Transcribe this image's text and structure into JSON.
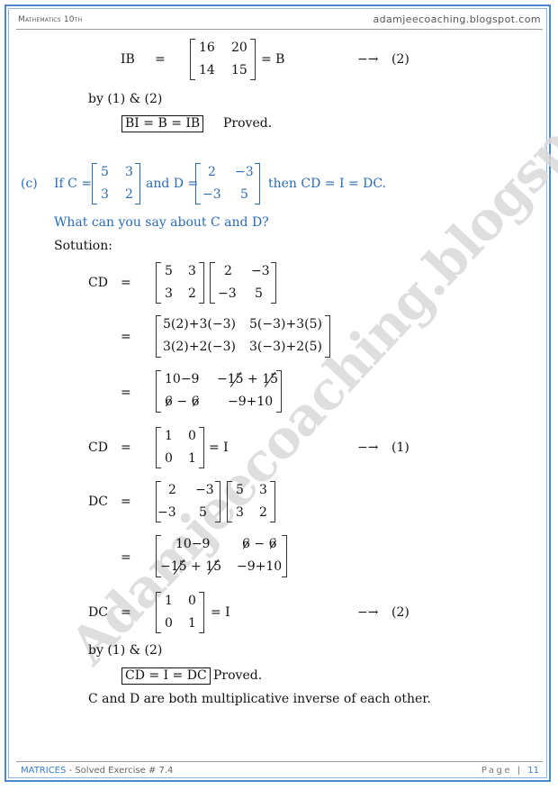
{
  "header": {
    "subject": "Mathematics 10th",
    "website": "adamjeecoaching.blogspot.com"
  },
  "footer": {
    "chapter": "MATRICES",
    "section": " - Solved Exercise # 7.4",
    "page_label": "Page",
    "page_number": "11"
  },
  "watermark": "Adamjeecoaching.blogspot.com",
  "colors": {
    "accent_blue": "#2a6bb5",
    "frame_blue": "#4a86c8"
  },
  "part_b_tail": {
    "ib_label": "IB",
    "eq": "=",
    "ib_matrix": [
      [
        "16",
        "20"
      ],
      [
        "14",
        "15"
      ]
    ],
    "ib_result": "= B",
    "arrow": "−→",
    "ref": "(2)",
    "by_line": "by (1) & (2)",
    "conclusion_boxed": "BI  =  B  =  IB",
    "proved": "Proved."
  },
  "part_c": {
    "label": "(c)",
    "if_text": "If  C =",
    "C": [
      [
        "5",
        "3"
      ],
      [
        "3",
        "2"
      ]
    ],
    "and_text": "and D =",
    "D": [
      [
        "2",
        "−3"
      ],
      [
        "−3",
        "5"
      ]
    ],
    "then_text": "then CD = I = DC.",
    "question": "What can you say about C and D?",
    "solution_label": "Sotution:",
    "steps": [
      {
        "lhs": "CD",
        "eq": "=",
        "left": [
          [
            "5",
            "3"
          ],
          [
            "3",
            "2"
          ]
        ],
        "right": [
          [
            "2",
            "−3"
          ],
          [
            "−3",
            "5"
          ]
        ]
      },
      {
        "lhs": "",
        "eq": "=",
        "matrix": [
          [
            "5(2)+3(−3)",
            "5(−3)+3(5)"
          ],
          [
            "3(2)+2(−3)",
            "3(−3)+2(5)"
          ]
        ]
      },
      {
        "lhs": "",
        "eq": "=",
        "matrix": [
          [
            "10−9",
            "−15 + 15"
          ],
          [
            "6 − 6",
            "−9+10"
          ]
        ],
        "cancelled": "15, 6"
      },
      {
        "lhs": "CD",
        "eq": "=",
        "matrix": [
          [
            "1",
            "0"
          ],
          [
            "0",
            "1"
          ]
        ],
        "result": "= I",
        "arrow": "−→",
        "ref": "(1)"
      },
      {
        "lhs": "DC",
        "eq": "=",
        "left": [
          [
            "2",
            "−3"
          ],
          [
            "−3",
            "5"
          ]
        ],
        "right": [
          [
            "5",
            "3"
          ],
          [
            "3",
            "2"
          ]
        ]
      },
      {
        "lhs": "",
        "eq": "=",
        "matrix": [
          [
            "10−9",
            "6 − 6"
          ],
          [
            "−15 + 15",
            "−9+10"
          ]
        ],
        "cancelled": "6, 15"
      },
      {
        "lhs": "DC",
        "eq": "=",
        "matrix": [
          [
            "1",
            "0"
          ],
          [
            "0",
            "1"
          ]
        ],
        "result": "= I",
        "arrow": "−→",
        "ref": "(2)"
      }
    ],
    "by_line": "by (1) & (2)",
    "conclusion_boxed": "CD  =  I  =  DC",
    "proved": "Proved.",
    "final_statement": "C and D are both multiplicative inverse of each other."
  }
}
